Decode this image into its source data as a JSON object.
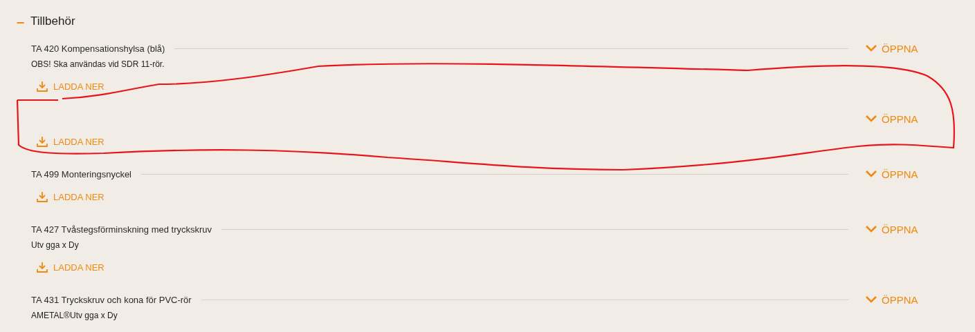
{
  "section": {
    "toggle": "–",
    "title": "Tillbehör"
  },
  "items": [
    {
      "title": "TA 420 Kompensationshylsa (blå)",
      "subtitle": "OBS! Ska användas vid SDR 11-rör.",
      "open_label": "ÖPPNA",
      "download_label": "LADDA NER"
    },
    {
      "open_label": "ÖPPNA",
      "download_label": "LADDA NER"
    },
    {
      "title": "TA 499 Monteringsnyckel",
      "open_label": "ÖPPNA",
      "download_label": "LADDA NER"
    },
    {
      "title": "TA 427 Tvåstegsförminskning med tryckskruv",
      "subtitle": "Utv gga x Dy",
      "open_label": "ÖPPNA",
      "download_label": "LADDA NER"
    },
    {
      "title": "TA 431 Tryckskruv och kona för PVC-rör",
      "subtitle": "AMETAL®Utv gga x Dy",
      "open_label": "ÖPPNA"
    }
  ],
  "annotation": {
    "kind": "loop"
  }
}
